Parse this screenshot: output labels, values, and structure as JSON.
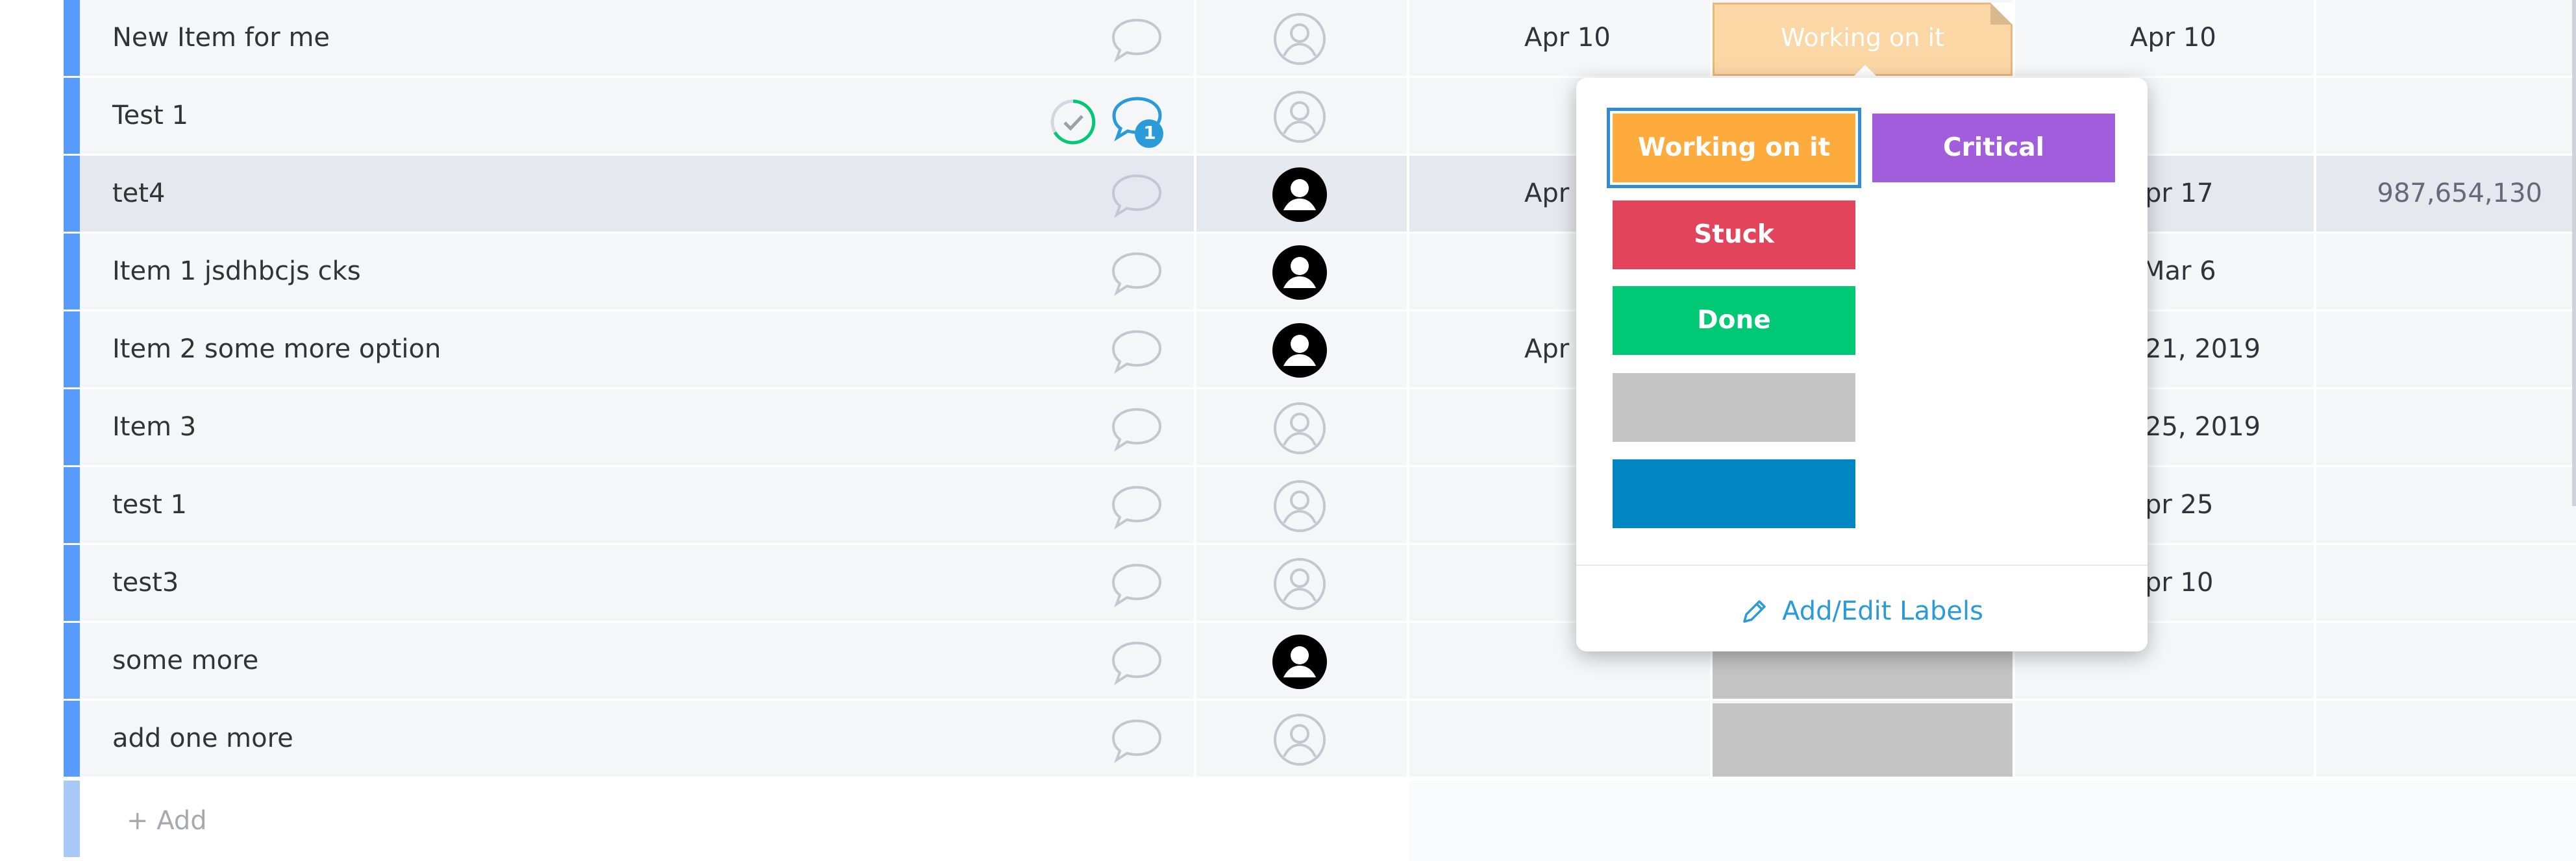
{
  "board": {
    "rows": [
      {
        "name": "New Item for me",
        "date1": "Apr 10",
        "status": "Working on it",
        "date2": "Apr 10",
        "number": "",
        "owner": "empty"
      },
      {
        "name": "Test 1",
        "date1": "",
        "status": "",
        "date2": "",
        "number": "",
        "owner": "empty",
        "comment_count": "1"
      },
      {
        "name": "tet4",
        "date1": "Apr",
        "status": "",
        "date2": "pr 17",
        "number": "987,654,130",
        "owner": "assigned"
      },
      {
        "name": "Item 1 jsdhbcjs cks",
        "date1": "",
        "status": "",
        "date2": "Mar 6",
        "number": "",
        "owner": "assigned"
      },
      {
        "name": "Item 2 some more option",
        "date1": "Apr",
        "status": "",
        "date2": "21, 2019",
        "number": "",
        "owner": "assigned"
      },
      {
        "name": "Item 3",
        "date1": "",
        "status": "",
        "date2": "25, 2019",
        "number": "",
        "owner": "empty"
      },
      {
        "name": "test 1",
        "date1": "",
        "status": "",
        "date2": "pr 25",
        "number": "",
        "owner": "empty"
      },
      {
        "name": "test3",
        "date1": "",
        "status": "",
        "date2": "pr 10",
        "number": "",
        "owner": "empty"
      },
      {
        "name": "some more",
        "date1": "",
        "status": "",
        "date2": "",
        "number": "",
        "owner": "assigned"
      },
      {
        "name": "add one more",
        "date1": "",
        "status": "",
        "date2": "",
        "number": "",
        "owner": "empty"
      }
    ],
    "add_item_label": "+ Add"
  },
  "status_picker": {
    "labels": [
      {
        "text": "Working on it",
        "color": "#fdab3d",
        "selected": true
      },
      {
        "text": "Critical",
        "color": "#a25ddc",
        "selected": false
      },
      {
        "text": "Stuck",
        "color": "#e2445c",
        "selected": false
      },
      {
        "text": "Done",
        "color": "#00c875",
        "selected": false
      },
      {
        "text": "",
        "color": "#c4c4c4",
        "selected": false
      },
      {
        "text": "",
        "color": "#0086c0",
        "selected": false
      }
    ],
    "edit_labels": "Add/Edit Labels",
    "edit_icon": "pencil-icon"
  },
  "colors": {
    "group_stripe": "#579bfc",
    "working_on_it_cell": "#fbd7a6",
    "empty_status_cell": "#c4c4c4",
    "link": "#2a9ad8"
  }
}
